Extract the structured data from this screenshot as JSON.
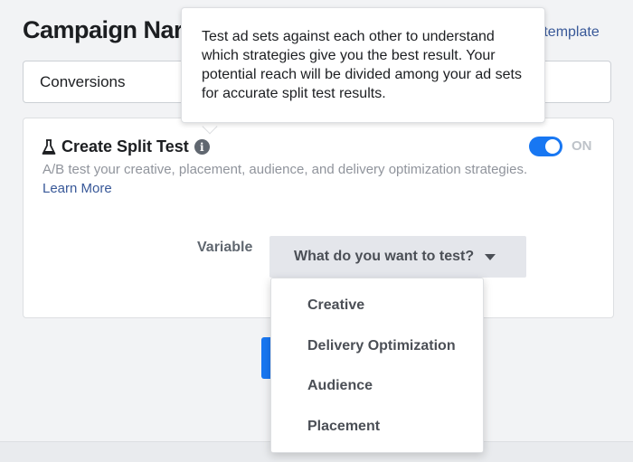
{
  "header": {
    "campaign_name_label": "Campaign Nar",
    "template_link": "e template"
  },
  "objective": {
    "value": "Conversions"
  },
  "split_test": {
    "title": "Create Split Test",
    "description": "A/B test your creative, placement, audience, and delivery optimization strategies.",
    "learn_more": "Learn More",
    "toggle_state": "ON",
    "variable_label": "Variable",
    "variable_select": "What do you want to test?"
  },
  "tooltip": {
    "text": "Test ad sets against each other to understand which strategies give you the best result. Your potential reach will be divided among your ad sets for accurate split test results."
  },
  "dropdown": {
    "items": [
      {
        "label": "Creative"
      },
      {
        "label": "Delivery Optimization"
      },
      {
        "label": "Audience"
      },
      {
        "label": "Placement"
      }
    ]
  },
  "colors": {
    "accent": "#1877f2",
    "link": "#385898",
    "muted_text": "#90949c"
  }
}
